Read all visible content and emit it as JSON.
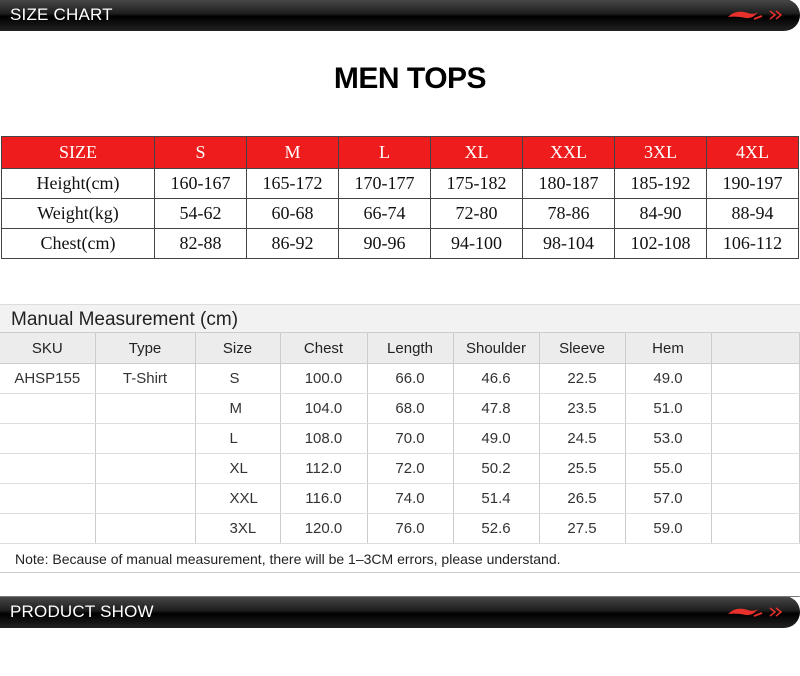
{
  "header": {
    "title": "SIZE CHART"
  },
  "product_title": "MEN TOPS",
  "size_chart": {
    "header": [
      "SIZE",
      "S",
      "M",
      "L",
      "XL",
      "XXL",
      "3XL",
      "4XL"
    ],
    "rows": [
      [
        "Height(cm)",
        "160-167",
        "165-172",
        "170-177",
        "175-182",
        "180-187",
        "185-192",
        "190-197"
      ],
      [
        "Weight(kg)",
        "54-62",
        "60-68",
        "66-74",
        "72-80",
        "78-86",
        "84-90",
        "88-94"
      ],
      [
        "Chest(cm)",
        "82-88",
        "86-92",
        "90-96",
        "94-100",
        "98-104",
        "102-108",
        "106-112"
      ]
    ]
  },
  "manual": {
    "title": "Manual Measurement (cm)",
    "columns": [
      "SKU",
      "Type",
      "Size",
      "Chest",
      "Length",
      "Shoulder",
      "Sleeve",
      "Hem",
      ""
    ],
    "rows": [
      [
        "AHSP155",
        "T-Shirt",
        "S",
        "100.0",
        "66.0",
        "46.6",
        "22.5",
        "49.0",
        ""
      ],
      [
        "",
        "",
        "M",
        "104.0",
        "68.0",
        "47.8",
        "23.5",
        "51.0",
        ""
      ],
      [
        "",
        "",
        "L",
        "108.0",
        "70.0",
        "49.0",
        "24.5",
        "53.0",
        ""
      ],
      [
        "",
        "",
        "XL",
        "112.0",
        "72.0",
        "50.2",
        "25.5",
        "55.0",
        ""
      ],
      [
        "",
        "",
        "XXL",
        "116.0",
        "74.0",
        "51.4",
        "26.5",
        "57.0",
        ""
      ],
      [
        "",
        "",
        "3XL",
        "120.0",
        "76.0",
        "52.6",
        "27.5",
        "59.0",
        ""
      ]
    ],
    "note": "Note: Because of manual measurement, there will be 1–3CM errors, please understand."
  },
  "footer": {
    "title": "PRODUCT SHOW"
  },
  "colors": {
    "header_red": "#ee1c1c",
    "logo_red": "#e8302c",
    "banner_dark": "#111111"
  },
  "icons": {
    "brand_logo": "brand-swoosh-logo-icon",
    "double_chevron": "double-chevron-right-icon"
  }
}
